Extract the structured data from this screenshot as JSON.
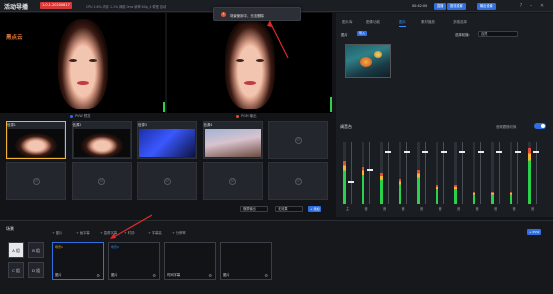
{
  "header": {
    "title": "活动导播",
    "live_badge": "1.0.1.20200617",
    "stats": "CPU 2.8%  内存 1.1%   网络 0ms    帧率 60p_4    带宽 自动",
    "timer": "00:42:00",
    "buttons": [
      "直播",
      "推流设置",
      "输出设置"
    ],
    "accent": "#2f6fe0"
  },
  "toast": {
    "icon": "warning-icon",
    "text": "场景使用中，无法删除"
  },
  "preview": {
    "pvw_label": "PVW 预览",
    "pgm_label": "PGM 输出",
    "logo_text": "黑点云",
    "pvw_color": "#2f6fe0",
    "pgm_color": "#e24d3a"
  },
  "right_panel": {
    "tabs": [
      "图片库",
      "图像功能",
      "图片",
      "素材播放",
      "多路选择"
    ],
    "active_tab": 2,
    "subtab_label": "图片",
    "import_label": "导入",
    "sort_label": "选择轮播:",
    "select_value": "自然"
  },
  "sources": {
    "cards": [
      {
        "label": "信源1",
        "kind": "face"
      },
      {
        "label": "信源2",
        "kind": "face-plain"
      },
      {
        "label": "信源3",
        "kind": "screen"
      },
      {
        "label": "信源4",
        "kind": "blossom"
      },
      {
        "label": "",
        "kind": "empty"
      },
      {
        "label": "",
        "kind": "empty"
      },
      {
        "label": "",
        "kind": "empty"
      },
      {
        "label": "",
        "kind": "empty"
      },
      {
        "label": "",
        "kind": "empty"
      },
      {
        "label": "",
        "kind": "empty"
      }
    ],
    "footer": {
      "select1": "横屏输出",
      "select2": "无效果",
      "add_button": "+ 添加"
    }
  },
  "mixer": {
    "title": "调音台",
    "toggle_label": "音频跟随切换",
    "toggle_on": true,
    "channels": [
      {
        "name": "主",
        "level": 0.7,
        "fader": 0.35
      },
      {
        "name": "音",
        "level": 0.6,
        "fader": 0.55
      },
      {
        "name": "音",
        "level": 0.5,
        "fader": 0.85
      },
      {
        "name": "音",
        "level": 0.4,
        "fader": 0.85
      },
      {
        "name": "音",
        "level": 0.55,
        "fader": 0.85
      },
      {
        "name": "音",
        "level": 0.3,
        "fader": 0.85
      },
      {
        "name": "音",
        "level": 0.3,
        "fader": 0.85
      },
      {
        "name": "音",
        "level": 0.2,
        "fader": 0.85
      },
      {
        "name": "音",
        "level": 0.2,
        "fader": 0.85
      },
      {
        "name": "音",
        "level": 0.2,
        "fader": 0.85
      },
      {
        "name": "音",
        "level": 0.9,
        "fader": 0.85
      }
    ]
  },
  "bottom": {
    "layer_tab": "场景",
    "toolbar": [
      "+ 图片",
      "+ 画字幕",
      "+ 直角字幕",
      "+ 时钟",
      "+ 字幕高",
      "+ 分辨率"
    ],
    "pvw_button": "+ PVW",
    "scene_buttons": [
      "A 组",
      "B 组",
      "C 组",
      "D 组"
    ],
    "active_scene_button": 0,
    "scenes": [
      {
        "name": "图片",
        "tag": "场景1"
      },
      {
        "name": "图片",
        "tag": "场景2"
      },
      {
        "name": "时间字幕",
        "tag": ""
      },
      {
        "name": "图片",
        "tag": ""
      }
    ]
  }
}
